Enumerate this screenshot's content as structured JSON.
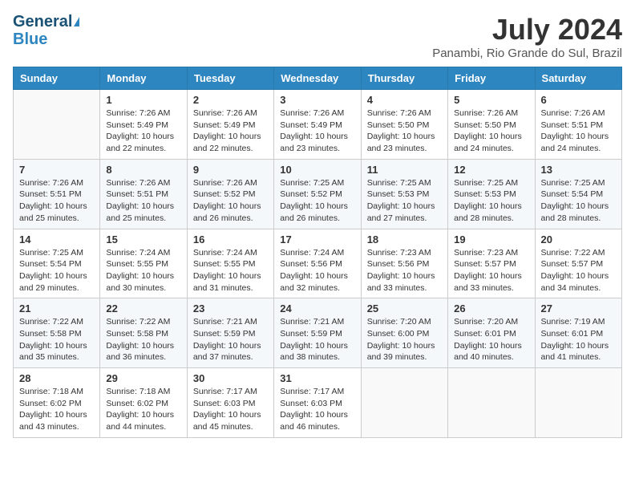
{
  "header": {
    "logo_line1": "General",
    "logo_line2": "Blue",
    "month": "July 2024",
    "location": "Panambi, Rio Grande do Sul, Brazil"
  },
  "days_of_week": [
    "Sunday",
    "Monday",
    "Tuesday",
    "Wednesday",
    "Thursday",
    "Friday",
    "Saturday"
  ],
  "weeks": [
    [
      {
        "day": "",
        "sunrise": "",
        "sunset": "",
        "daylight": ""
      },
      {
        "day": "1",
        "sunrise": "Sunrise: 7:26 AM",
        "sunset": "Sunset: 5:49 PM",
        "daylight": "Daylight: 10 hours and 22 minutes."
      },
      {
        "day": "2",
        "sunrise": "Sunrise: 7:26 AM",
        "sunset": "Sunset: 5:49 PM",
        "daylight": "Daylight: 10 hours and 22 minutes."
      },
      {
        "day": "3",
        "sunrise": "Sunrise: 7:26 AM",
        "sunset": "Sunset: 5:49 PM",
        "daylight": "Daylight: 10 hours and 23 minutes."
      },
      {
        "day": "4",
        "sunrise": "Sunrise: 7:26 AM",
        "sunset": "Sunset: 5:50 PM",
        "daylight": "Daylight: 10 hours and 23 minutes."
      },
      {
        "day": "5",
        "sunrise": "Sunrise: 7:26 AM",
        "sunset": "Sunset: 5:50 PM",
        "daylight": "Daylight: 10 hours and 24 minutes."
      },
      {
        "day": "6",
        "sunrise": "Sunrise: 7:26 AM",
        "sunset": "Sunset: 5:51 PM",
        "daylight": "Daylight: 10 hours and 24 minutes."
      }
    ],
    [
      {
        "day": "7",
        "sunrise": "Sunrise: 7:26 AM",
        "sunset": "Sunset: 5:51 PM",
        "daylight": "Daylight: 10 hours and 25 minutes."
      },
      {
        "day": "8",
        "sunrise": "Sunrise: 7:26 AM",
        "sunset": "Sunset: 5:51 PM",
        "daylight": "Daylight: 10 hours and 25 minutes."
      },
      {
        "day": "9",
        "sunrise": "Sunrise: 7:26 AM",
        "sunset": "Sunset: 5:52 PM",
        "daylight": "Daylight: 10 hours and 26 minutes."
      },
      {
        "day": "10",
        "sunrise": "Sunrise: 7:25 AM",
        "sunset": "Sunset: 5:52 PM",
        "daylight": "Daylight: 10 hours and 26 minutes."
      },
      {
        "day": "11",
        "sunrise": "Sunrise: 7:25 AM",
        "sunset": "Sunset: 5:53 PM",
        "daylight": "Daylight: 10 hours and 27 minutes."
      },
      {
        "day": "12",
        "sunrise": "Sunrise: 7:25 AM",
        "sunset": "Sunset: 5:53 PM",
        "daylight": "Daylight: 10 hours and 28 minutes."
      },
      {
        "day": "13",
        "sunrise": "Sunrise: 7:25 AM",
        "sunset": "Sunset: 5:54 PM",
        "daylight": "Daylight: 10 hours and 28 minutes."
      }
    ],
    [
      {
        "day": "14",
        "sunrise": "Sunrise: 7:25 AM",
        "sunset": "Sunset: 5:54 PM",
        "daylight": "Daylight: 10 hours and 29 minutes."
      },
      {
        "day": "15",
        "sunrise": "Sunrise: 7:24 AM",
        "sunset": "Sunset: 5:55 PM",
        "daylight": "Daylight: 10 hours and 30 minutes."
      },
      {
        "day": "16",
        "sunrise": "Sunrise: 7:24 AM",
        "sunset": "Sunset: 5:55 PM",
        "daylight": "Daylight: 10 hours and 31 minutes."
      },
      {
        "day": "17",
        "sunrise": "Sunrise: 7:24 AM",
        "sunset": "Sunset: 5:56 PM",
        "daylight": "Daylight: 10 hours and 32 minutes."
      },
      {
        "day": "18",
        "sunrise": "Sunrise: 7:23 AM",
        "sunset": "Sunset: 5:56 PM",
        "daylight": "Daylight: 10 hours and 33 minutes."
      },
      {
        "day": "19",
        "sunrise": "Sunrise: 7:23 AM",
        "sunset": "Sunset: 5:57 PM",
        "daylight": "Daylight: 10 hours and 33 minutes."
      },
      {
        "day": "20",
        "sunrise": "Sunrise: 7:22 AM",
        "sunset": "Sunset: 5:57 PM",
        "daylight": "Daylight: 10 hours and 34 minutes."
      }
    ],
    [
      {
        "day": "21",
        "sunrise": "Sunrise: 7:22 AM",
        "sunset": "Sunset: 5:58 PM",
        "daylight": "Daylight: 10 hours and 35 minutes."
      },
      {
        "day": "22",
        "sunrise": "Sunrise: 7:22 AM",
        "sunset": "Sunset: 5:58 PM",
        "daylight": "Daylight: 10 hours and 36 minutes."
      },
      {
        "day": "23",
        "sunrise": "Sunrise: 7:21 AM",
        "sunset": "Sunset: 5:59 PM",
        "daylight": "Daylight: 10 hours and 37 minutes."
      },
      {
        "day": "24",
        "sunrise": "Sunrise: 7:21 AM",
        "sunset": "Sunset: 5:59 PM",
        "daylight": "Daylight: 10 hours and 38 minutes."
      },
      {
        "day": "25",
        "sunrise": "Sunrise: 7:20 AM",
        "sunset": "Sunset: 6:00 PM",
        "daylight": "Daylight: 10 hours and 39 minutes."
      },
      {
        "day": "26",
        "sunrise": "Sunrise: 7:20 AM",
        "sunset": "Sunset: 6:01 PM",
        "daylight": "Daylight: 10 hours and 40 minutes."
      },
      {
        "day": "27",
        "sunrise": "Sunrise: 7:19 AM",
        "sunset": "Sunset: 6:01 PM",
        "daylight": "Daylight: 10 hours and 41 minutes."
      }
    ],
    [
      {
        "day": "28",
        "sunrise": "Sunrise: 7:18 AM",
        "sunset": "Sunset: 6:02 PM",
        "daylight": "Daylight: 10 hours and 43 minutes."
      },
      {
        "day": "29",
        "sunrise": "Sunrise: 7:18 AM",
        "sunset": "Sunset: 6:02 PM",
        "daylight": "Daylight: 10 hours and 44 minutes."
      },
      {
        "day": "30",
        "sunrise": "Sunrise: 7:17 AM",
        "sunset": "Sunset: 6:03 PM",
        "daylight": "Daylight: 10 hours and 45 minutes."
      },
      {
        "day": "31",
        "sunrise": "Sunrise: 7:17 AM",
        "sunset": "Sunset: 6:03 PM",
        "daylight": "Daylight: 10 hours and 46 minutes."
      },
      {
        "day": "",
        "sunrise": "",
        "sunset": "",
        "daylight": ""
      },
      {
        "day": "",
        "sunrise": "",
        "sunset": "",
        "daylight": ""
      },
      {
        "day": "",
        "sunrise": "",
        "sunset": "",
        "daylight": ""
      }
    ]
  ]
}
